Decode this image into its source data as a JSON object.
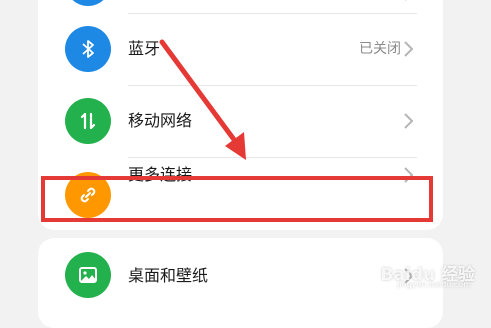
{
  "settings": {
    "bluetooth": {
      "label": "蓝牙",
      "value": "已关闭"
    },
    "mobile_network": {
      "label": "移动网络"
    },
    "more_connections": {
      "label": "更多连接"
    },
    "desktop_wallpaper": {
      "label": "桌面和壁纸"
    }
  },
  "watermark": {
    "text": "Baidu 经验",
    "sub": "jingyan.baidu.com"
  },
  "colors": {
    "bluetooth": "#1e88e5",
    "mobile_network": "#22b14c",
    "more_connections": "#ff9800",
    "desktop_wallpaper": "#22b14c",
    "annotation": "#e53935"
  },
  "icons": {
    "bluetooth": "bluetooth-icon",
    "mobile_network": "mobile-data-icon",
    "more_connections": "link-icon",
    "desktop_wallpaper": "image-icon",
    "chevron": "chevron-right-icon"
  }
}
